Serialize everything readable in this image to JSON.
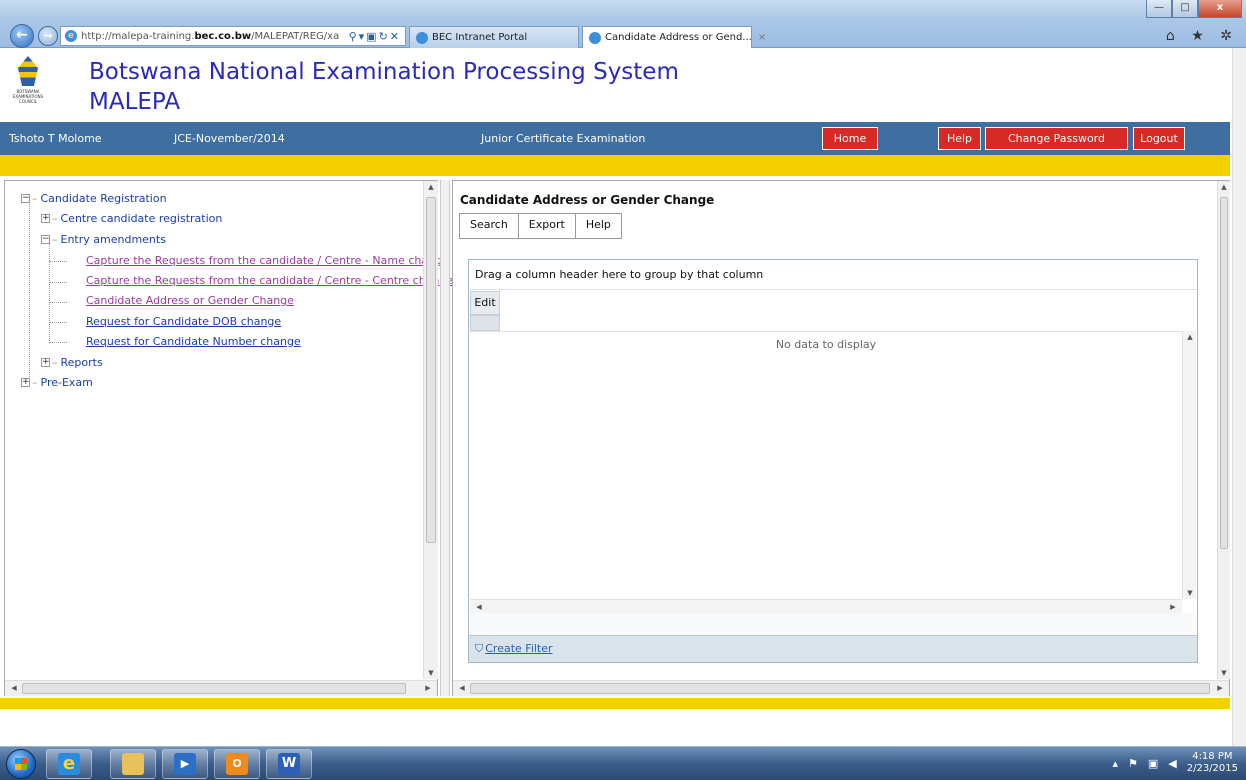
{
  "browser": {
    "url_prefix": "http://malepa-training.",
    "url_domain": "bec.co.bw",
    "url_rest": "/MALEPAT/REG/xa",
    "tabs": [
      {
        "label": "BEC Intranet Portal"
      },
      {
        "label": "Candidate Address or Gend...",
        "close": "×"
      }
    ],
    "window_controls": {
      "minimize": "—",
      "maximize": "□",
      "close": "x"
    },
    "right_tools": "⌂ ★ ✲"
  },
  "app": {
    "title_line1": "Botswana National Examination Processing System",
    "title_line2": "MALEPA",
    "logo_text": "BOTSWANA EXAMINATIONS COUNCIL"
  },
  "info_bar": {
    "user": "Tshoto T Molome",
    "session": "JCE-November/2014",
    "exam": "Junior Certificate Examination",
    "buttons": {
      "home": "Home",
      "help": "Help",
      "change_password": "Change Password",
      "logout": "Logout"
    },
    "colors": {
      "bar": "#3f6fa0",
      "button": "#d82a24",
      "accent": "#f4d000"
    }
  },
  "tree": {
    "root": {
      "label": "Candidate Registration",
      "toggle": "−"
    },
    "centre_registration": {
      "label": "Centre candidate registration",
      "toggle": "+"
    },
    "entry_amendments": {
      "label": "Entry amendments",
      "toggle": "−"
    },
    "links": [
      {
        "label": "Capture the Requests from the candidate / Centre - Name change"
      },
      {
        "label": "Capture the Requests from the candidate / Centre - Centre change"
      },
      {
        "label": "Candidate Address or Gender Change"
      },
      {
        "label": "Request for Candidate DOB change"
      },
      {
        "label": "Request for Candidate Number change"
      }
    ],
    "reports": {
      "label": "Reports",
      "toggle": "+"
    },
    "pre_exam": {
      "label": "Pre-Exam",
      "toggle": "+"
    }
  },
  "content": {
    "title": "Candidate Address or Gender Change",
    "toolbar": {
      "search": "Search",
      "export": "Export",
      "help": "Help"
    },
    "grid": {
      "group_panel_text": "Drag a column header here to group by that column",
      "columns": [
        "Edit"
      ],
      "empty_text": "No data to display",
      "create_filter": "Create Filter"
    }
  },
  "taskbar": {
    "time": "4:18 PM",
    "date": "2/23/2015",
    "apps": [
      "internet-explorer",
      "file-explorer",
      "media-player",
      "outlook",
      "word"
    ]
  }
}
